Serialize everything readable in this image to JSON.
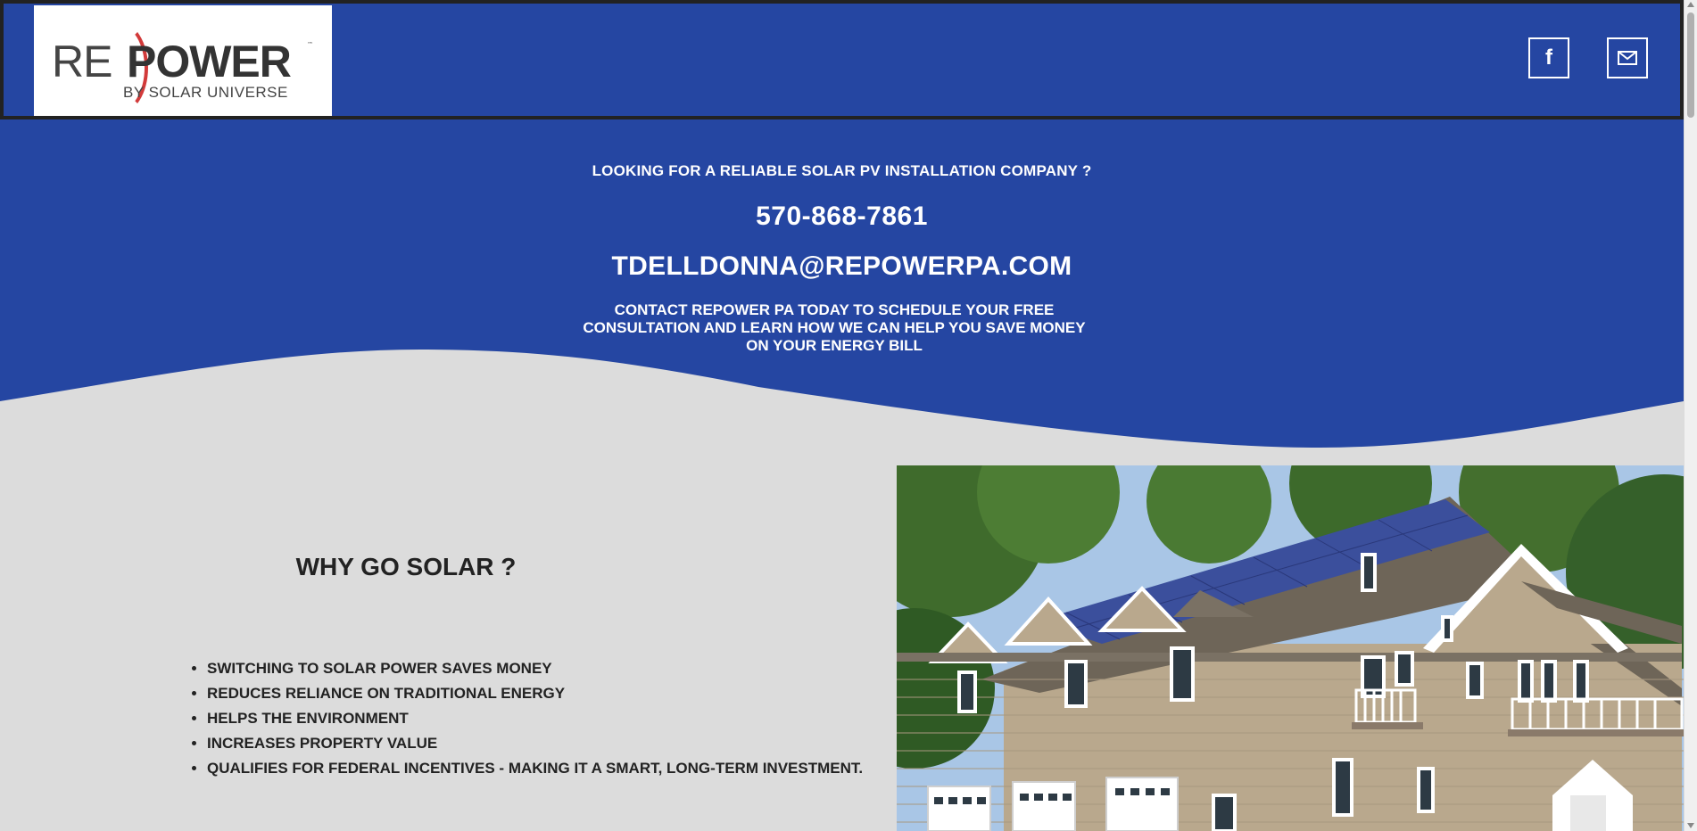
{
  "header": {
    "logo": {
      "re": "RE",
      "power": "POWER",
      "tm": "™",
      "subtitle": "BY SOLAR UNIVERSE"
    },
    "social": {
      "facebook_glyph": "f",
      "facebook_icon": "facebook-icon",
      "email_icon": "mail-icon"
    },
    "colors": {
      "bar": "#2546a2",
      "border": "#222222",
      "logo_arc": "#d23a3a"
    }
  },
  "hero": {
    "question": "LOOKING FOR A RELIABLE SOLAR PV INSTALLATION COMPANY ?",
    "phone": "570-868-7861",
    "email": "TDELLDONNA@REPOWERPA.COM",
    "cta": "CONTACT REPOWER PA TODAY TO SCHEDULE YOUR FREE CONSULTATION AND LEARN HOW WE CAN HELP YOU SAVE MONEY ON YOUR ENERGY BILL",
    "colors": {
      "background": "#2546a2",
      "text": "#ffffff"
    }
  },
  "why_solar": {
    "title": "WHY GO SOLAR ?",
    "benefits": [
      "SWITCHING TO SOLAR POWER SAVES MONEY",
      "REDUCES RELIANCE ON TRADITIONAL ENERGY",
      "HELPS THE ENVIRONMENT",
      "INCREASES PROPERTY VALUE",
      "QUALIFIES FOR FEDERAL INCENTIVES - MAKING IT A SMART, LONG-TERM INVESTMENT."
    ]
  },
  "image": {
    "icon": "solar-house-photo"
  },
  "page_colors": {
    "background": "#dcdcdc",
    "text": "#222222"
  }
}
